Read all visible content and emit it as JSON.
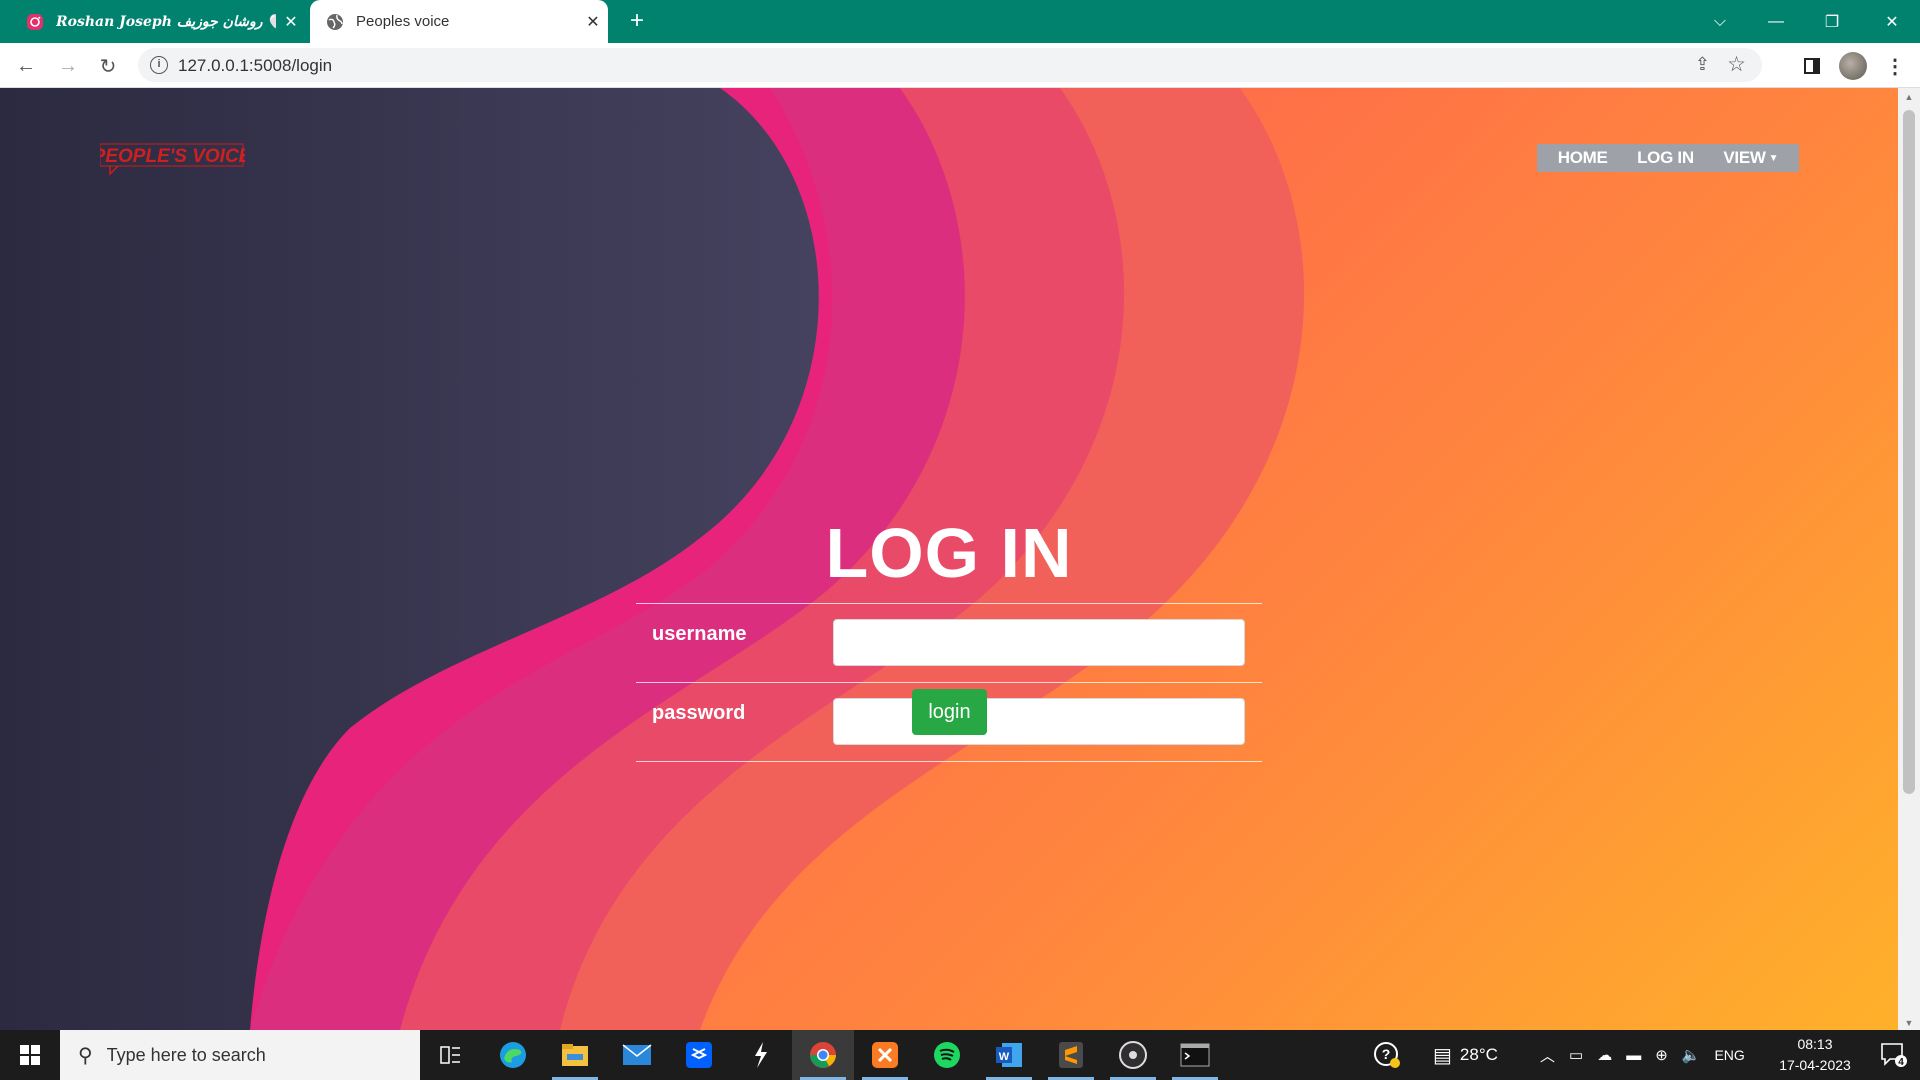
{
  "browser": {
    "tabs": [
      {
        "title": "Roshan Joseph روشان جوزيف 🤍",
        "active": false,
        "favicon": "instagram-icon"
      },
      {
        "title": "Peoples voice",
        "active": true,
        "favicon": "globe-icon"
      }
    ],
    "url": "127.0.0.1:5008/login"
  },
  "page": {
    "logo_text": "PEOPLE'S VOICE",
    "nav": [
      {
        "label": "HOME"
      },
      {
        "label": "LOG IN"
      },
      {
        "label": "VIEW"
      }
    ],
    "heading": "LOG IN",
    "form": {
      "username_label": "username",
      "password_label": "password",
      "username_value": "",
      "password_value": "",
      "submit_label": "login"
    }
  },
  "taskbar": {
    "search_placeholder": "Type here to search",
    "weather": "28°C",
    "language": "ENG",
    "time": "08:13",
    "date": "17-04-2023",
    "notifications_count": "4"
  },
  "colors": {
    "tabbar": "#00826f",
    "login_button": "#28a745",
    "nav_bg": "#9ea1a8"
  }
}
